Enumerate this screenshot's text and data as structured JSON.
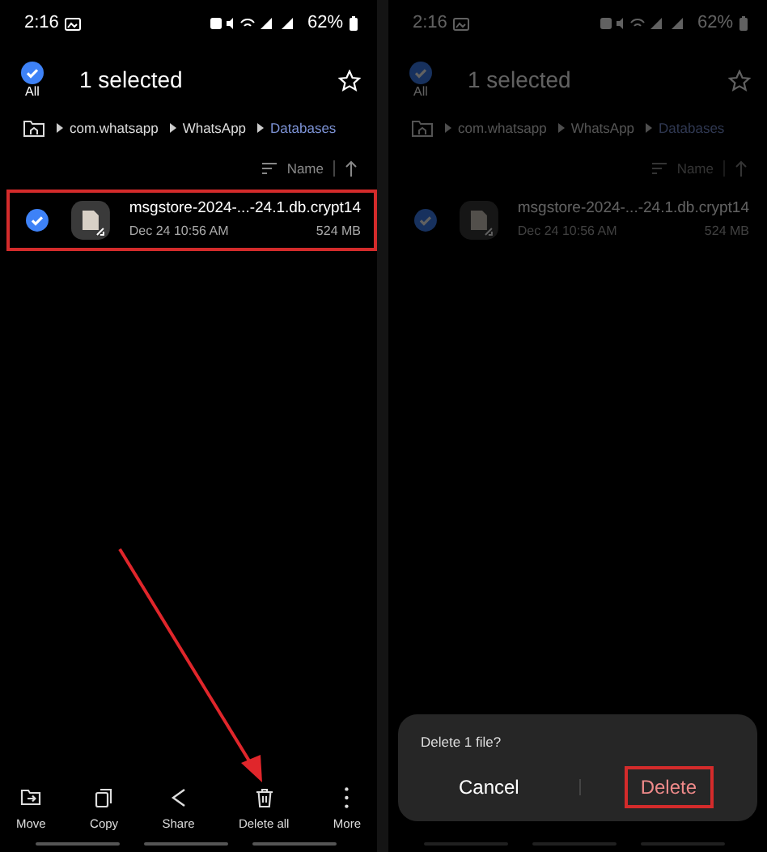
{
  "screens": [
    {
      "dimmed": false,
      "status_bar": {
        "time": "2:16",
        "battery": "62%"
      },
      "header": {
        "all_label": "All",
        "all_checked": true,
        "title": "1 selected"
      },
      "breadcrumb": [
        {
          "label": "com.whatsapp",
          "current": false
        },
        {
          "label": "WhatsApp",
          "current": false
        },
        {
          "label": "Databases",
          "current": true
        }
      ],
      "sort": {
        "label": "Name"
      },
      "files": [
        {
          "name": "msgstore-2024-...-24.1.db.crypt14",
          "date": "Dec 24 10:56 AM",
          "size": "524 MB",
          "selected": true,
          "highlighted": true
        }
      ],
      "bottom_bar": [
        {
          "kind": "move",
          "label": "Move"
        },
        {
          "kind": "copy",
          "label": "Copy"
        },
        {
          "kind": "share",
          "label": "Share"
        },
        {
          "kind": "delete",
          "label": "Delete all"
        },
        {
          "kind": "more",
          "label": "More"
        }
      ],
      "arrow": true
    },
    {
      "dimmed": true,
      "status_bar": {
        "time": "2:16",
        "battery": "62%"
      },
      "header": {
        "all_label": "All",
        "all_checked": true,
        "title": "1 selected"
      },
      "breadcrumb": [
        {
          "label": "com.whatsapp",
          "current": false
        },
        {
          "label": "WhatsApp",
          "current": false
        },
        {
          "label": "Databases",
          "current": true
        }
      ],
      "sort": {
        "label": "Name"
      },
      "files": [
        {
          "name": "msgstore-2024-...-24.1.db.crypt14",
          "date": "Dec 24 10:56 AM",
          "size": "524 MB",
          "selected": true,
          "highlighted": false
        }
      ],
      "dialog": {
        "message": "Delete 1 file?",
        "buttons": [
          {
            "kind": "cancel",
            "label": "Cancel",
            "highlighted": false
          },
          {
            "kind": "confirm",
            "label": "Delete",
            "highlighted": true
          }
        ]
      },
      "arrow": false
    }
  ]
}
